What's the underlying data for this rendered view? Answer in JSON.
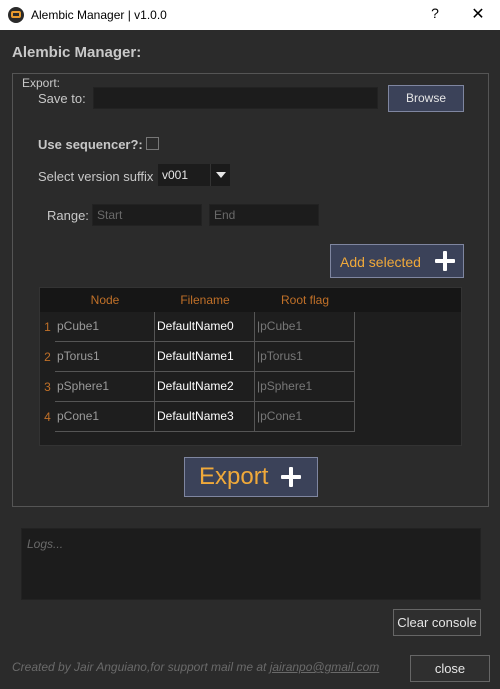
{
  "window": {
    "title": "Alembic Manager | v1.0.0",
    "help_glyph": "?",
    "close_glyph": "✕"
  },
  "header": {
    "title": "Alembic Manager:"
  },
  "export_group": {
    "title": "Export:",
    "save_to_label": "Save to:",
    "save_to_value": "",
    "browse_label": "Browse",
    "use_sequencer_label": "Use sequencer?:",
    "use_sequencer_checked": false,
    "version_suffix_label": "Select version suffix",
    "version_suffix_value": "v001",
    "range_label": "Range:",
    "range_start_placeholder": "Start",
    "range_end_placeholder": "End",
    "add_selected_label": "Add selected",
    "export_label": "Export"
  },
  "table": {
    "columns": [
      "Node",
      "Filename",
      "Root flag"
    ],
    "rows": [
      {
        "num": "1",
        "node": "pCube1",
        "filename": "DefaultName0",
        "root_flag": "|pCube1"
      },
      {
        "num": "2",
        "node": "pTorus1",
        "filename": "DefaultName1",
        "root_flag": "|pTorus1"
      },
      {
        "num": "3",
        "node": "pSphere1",
        "filename": "DefaultName2",
        "root_flag": "|pSphere1"
      },
      {
        "num": "4",
        "node": "pCone1",
        "filename": "DefaultName3",
        "root_flag": "|pCone1"
      }
    ]
  },
  "console": {
    "placeholder": "Logs...",
    "clear_label": "Clear console"
  },
  "footer": {
    "credit_text": "Created by Jair Anguiano,for support mail me at ",
    "email": "jairanpo@gmail.com",
    "close_label": "close"
  },
  "colors": {
    "background": "#2b2b2b",
    "accent_orange": "#f0a93a",
    "button_blue": "#3b4259"
  }
}
